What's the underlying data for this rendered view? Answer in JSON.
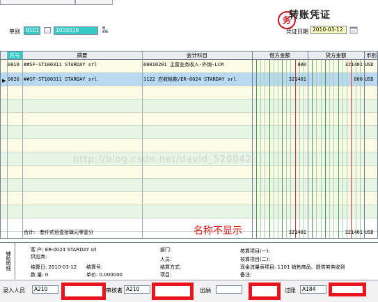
{
  "header": {
    "title": "转账凭证",
    "stamp": "务",
    "voucher_label": "单别",
    "voucher_code": "9101",
    "voucher_no": "1003016",
    "date_label": "凭证日期",
    "date_value": "2010-03-12"
  },
  "table": {
    "columns": [
      "凭号",
      "摘要",
      "会计科目",
      "借方金额",
      "贷方金额",
      "币别"
    ],
    "rows": [
      {
        "no": "0010",
        "summary": "##SF-ST100311 STARDAY srl",
        "account": "60010201 主营业务收入-外销-LCM",
        "debit": "000",
        "credit": "321401",
        "currency": "USD"
      },
      {
        "no": "0020",
        "summary": "##SF-ST100311 STARDAY srl",
        "account": "1122 应收帐款/ER-0024 STARDAY srl",
        "debit": "321401",
        "credit": "000",
        "currency": "USD"
      }
    ],
    "total_label": "合计:",
    "total_text": "叁仟贰佰壹拾肆元零壹分",
    "total_debit": "321401",
    "total_credit": "321401",
    "total_currency": "USD",
    "note": "名称不显示"
  },
  "watermark": "http://blog.csdn.net/david_520042",
  "detail": {
    "tab_label": "辅助明细",
    "customer": "客  户: ER-0024 STARDAY srl",
    "supplier": "供应商:",
    "settle_date": "结算日: 2010-03-12",
    "settle_no": "结算号:",
    "quantity": "数  量: 0",
    "price": "单价: 0.000000",
    "department": "部门:",
    "person": "人员:",
    "settle_method": "结算方式:",
    "project": "项目:",
    "item1": "核算项目(一):",
    "item2": "核算项目(二):",
    "cashflow": "现金流量表项目: 1101 销售商品、提供劳务收到",
    "remark": "备注:"
  },
  "footer": {
    "entry_label": "录入人员",
    "entry_value": "A210",
    "audit_label": "审核者",
    "audit_value": "A210",
    "cashier_label": "出纳",
    "cashier_value": "",
    "post_label": "过账",
    "post_value": "A184"
  }
}
